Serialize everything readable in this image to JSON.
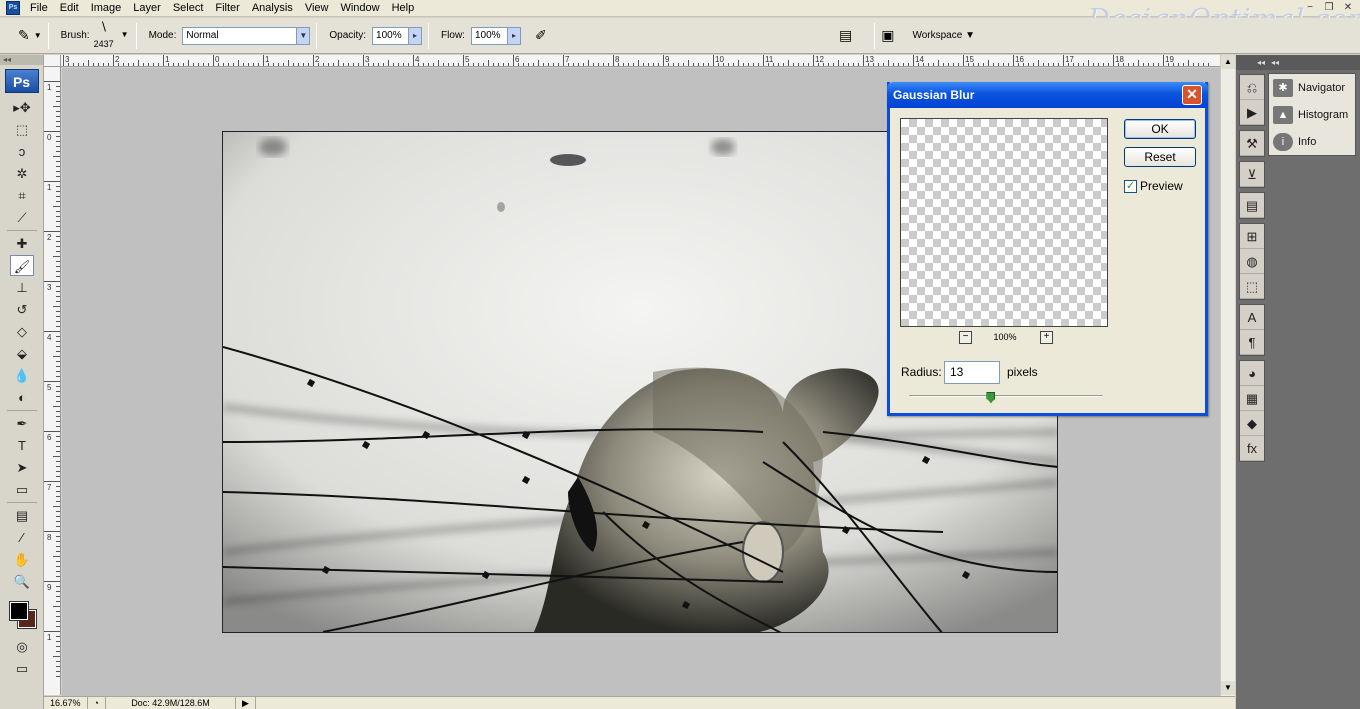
{
  "app": {
    "icon": "photoshop-app-icon",
    "watermark": "DesignOptimal.com"
  },
  "menu": {
    "items": [
      "File",
      "Edit",
      "Image",
      "Layer",
      "Select",
      "Filter",
      "Analysis",
      "View",
      "Window",
      "Help"
    ]
  },
  "window_buttons": [
    "−",
    "❐",
    "✕"
  ],
  "options": {
    "brush_label": "Brush:",
    "brush_size": "2437",
    "mode_label": "Mode:",
    "mode_value": "Normal",
    "opacity_label": "Opacity:",
    "opacity_value": "100%",
    "flow_label": "Flow:",
    "flow_value": "100%",
    "workspace_label": "Workspace",
    "workspace_arrow": "▼"
  },
  "toolbox": {
    "logo": "Ps",
    "tools": [
      {
        "name": "move-tool-icon",
        "glyph": "▸✥"
      },
      {
        "name": "marquee-tool-icon",
        "glyph": "⬚"
      },
      {
        "name": "lasso-tool-icon",
        "glyph": "ↄ"
      },
      {
        "name": "magic-wand-tool-icon",
        "glyph": "✲"
      },
      {
        "name": "crop-tool-icon",
        "glyph": "⌗"
      },
      {
        "name": "slice-tool-icon",
        "glyph": "⟋"
      },
      {
        "name": "healing-brush-tool-icon",
        "glyph": "✚"
      },
      {
        "name": "brush-tool-icon",
        "glyph": "🖌"
      },
      {
        "name": "clone-stamp-tool-icon",
        "glyph": "⊥"
      },
      {
        "name": "history-brush-tool-icon",
        "glyph": "↺"
      },
      {
        "name": "eraser-tool-icon",
        "glyph": "◇"
      },
      {
        "name": "paint-bucket-tool-icon",
        "glyph": "⬙"
      },
      {
        "name": "blur-tool-icon",
        "glyph": "💧"
      },
      {
        "name": "dodge-tool-icon",
        "glyph": "◐"
      },
      {
        "name": "pen-tool-icon",
        "glyph": "✒"
      },
      {
        "name": "type-tool-icon",
        "glyph": "T"
      },
      {
        "name": "path-selection-tool-icon",
        "glyph": "➤"
      },
      {
        "name": "rectangle-tool-icon",
        "glyph": "▭"
      },
      {
        "name": "notes-tool-icon",
        "glyph": "▤"
      },
      {
        "name": "eyedropper-tool-icon",
        "glyph": "⁄"
      },
      {
        "name": "hand-tool-icon",
        "glyph": "✋"
      },
      {
        "name": "zoom-tool-icon",
        "glyph": "🔍"
      }
    ],
    "foreground_color": "#000000",
    "background_color": "#5a2418"
  },
  "ruler_top": [
    "3",
    "2",
    "1",
    "0",
    "1",
    "2",
    "3",
    "4",
    "5",
    "6",
    "7",
    "8",
    "9",
    "10",
    "11",
    "12",
    "13",
    "14",
    "15",
    "16",
    "17",
    "18",
    "19"
  ],
  "ruler_left": [
    "1",
    "0",
    "1",
    "2",
    "3",
    "4",
    "5",
    "6",
    "7",
    "8",
    "9",
    "1"
  ],
  "status": {
    "zoom": "16.67%",
    "doc": "Doc: 42.9M/128.6M",
    "arrow": "▶"
  },
  "dock_icons": [
    [
      "history-icon",
      "actions-icon"
    ],
    [
      "tool-presets-icon"
    ],
    [
      "brush-clone-icon"
    ],
    [
      "layer-comps-icon"
    ],
    [
      "clone-source-icon",
      "masks-icon",
      "transform-icon"
    ],
    [
      "character-icon",
      "paragraph-icon"
    ],
    [
      "swatches-icon",
      "styles-icon",
      "layers-icon",
      "fx-icon"
    ]
  ],
  "panels": [
    {
      "icon": "navigator-icon",
      "glyph": "✱",
      "label": "Navigator"
    },
    {
      "icon": "histogram-icon",
      "glyph": "▲",
      "label": "Histogram"
    },
    {
      "icon": "info-icon",
      "glyph": "i",
      "label": "Info"
    }
  ],
  "dialog": {
    "title": "Gaussian Blur",
    "close": "✕",
    "ok_label": "OK",
    "reset_label": "Reset",
    "preview_label": "Preview",
    "preview_checked": true,
    "zoom_minus": "−",
    "zoom_plus": "+",
    "zoom_value": "100%",
    "radius_label": "Radius:",
    "radius_value": "13",
    "radius_unit": "pixels",
    "radius_level": 0.42
  }
}
